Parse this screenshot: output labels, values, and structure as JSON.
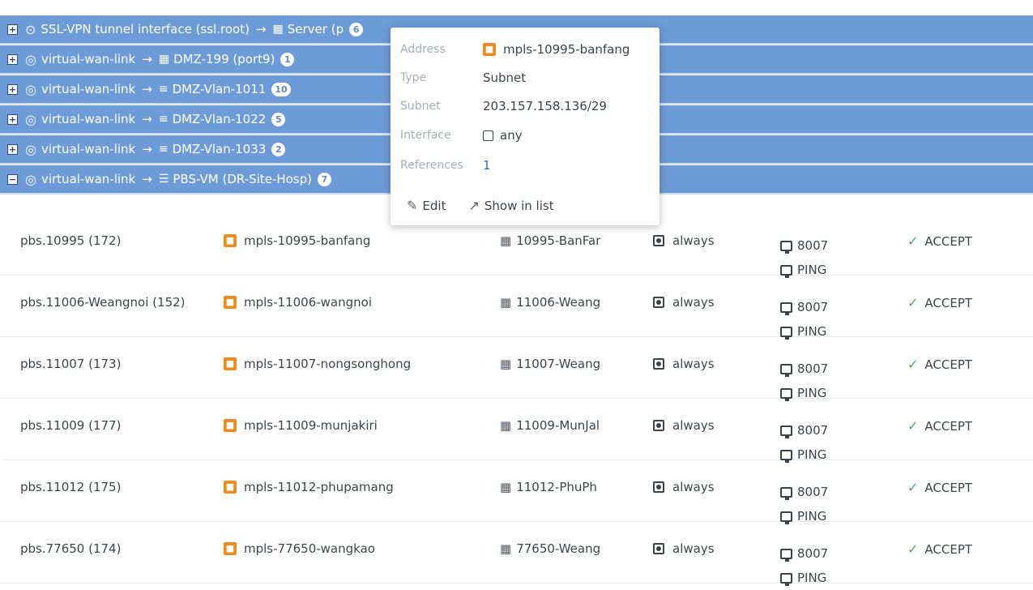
{
  "sections": [
    {
      "from_icon": "tunnel-icon",
      "from": "SSL-VPN tunnel interface (ssl.root)",
      "to_icon": "server-icon",
      "to": "Server (p",
      "count": "6"
    },
    {
      "from_icon": "wan-icon",
      "from": "virtual-wan-link",
      "to_icon": "interface-icon",
      "to": "DMZ-199 (port9)",
      "count": "1"
    },
    {
      "from_icon": "wan-icon",
      "from": "virtual-wan-link",
      "to_icon": "vlan-icon",
      "to": "DMZ-Vlan-1011",
      "count": "10"
    },
    {
      "from_icon": "wan-icon",
      "from": "virtual-wan-link",
      "to_icon": "vlan-icon",
      "to": "DMZ-Vlan-1022",
      "count": "5"
    },
    {
      "from_icon": "wan-icon",
      "from": "virtual-wan-link",
      "to_icon": "vlan-icon",
      "to": "DMZ-Vlan-1033",
      "count": "2"
    },
    {
      "from_icon": "wan-icon",
      "from": "virtual-wan-link",
      "to_icon": "vm-icon",
      "to": "PBS-VM (DR-Site-Hosp)",
      "count": "7"
    }
  ],
  "section_arrow": "→",
  "policies": [
    {
      "name": "pbs.10995 (172)",
      "source": "mpls-10995-banfang",
      "destination": "10995-BanFar",
      "schedule": "always",
      "services": [
        "8007",
        "PING"
      ],
      "action": "ACCEPT"
    },
    {
      "name": "pbs.11006-Weangnoi (152)",
      "source": "mpls-11006-wangnoi",
      "destination": "11006-Weang",
      "schedule": "always",
      "services": [
        "8007",
        "PING"
      ],
      "action": "ACCEPT"
    },
    {
      "name": "pbs.11007 (173)",
      "source": "mpls-11007-nongsonghong",
      "destination": "11007-Weang",
      "schedule": "always",
      "services": [
        "8007",
        "PING"
      ],
      "action": "ACCEPT"
    },
    {
      "name": "pbs.11009 (177)",
      "source": "mpls-11009-munjakiri",
      "destination": "11009-MunJal",
      "schedule": "always",
      "services": [
        "8007",
        "PING"
      ],
      "action": "ACCEPT"
    },
    {
      "name": "pbs.11012 (175)",
      "source": "mpls-11012-phupamang",
      "destination": "11012-PhuPh",
      "schedule": "always",
      "services": [
        "8007",
        "PING"
      ],
      "action": "ACCEPT"
    },
    {
      "name": "pbs.77650 (174)",
      "source": "mpls-77650-wangkao",
      "destination": "77650-Weang",
      "schedule": "always",
      "services": [
        "8007",
        "PING"
      ],
      "action": "ACCEPT"
    }
  ],
  "popover": {
    "address_label": "Address",
    "address_value": "mpls-10995-banfang",
    "type_label": "Type",
    "type_value": "Subnet",
    "subnet_label": "Subnet",
    "subnet_value": "203.157.158.136/29",
    "interface_label": "Interface",
    "interface_value": "any",
    "references_label": "References",
    "references_value": "1",
    "edit_label": "Edit",
    "show_in_list_label": "Show in list"
  },
  "colors": {
    "section_header": "#6d9bd8",
    "address_icon": "#f08a1c",
    "accept_check": "#4fa36b",
    "link": "#2f6bb5"
  }
}
